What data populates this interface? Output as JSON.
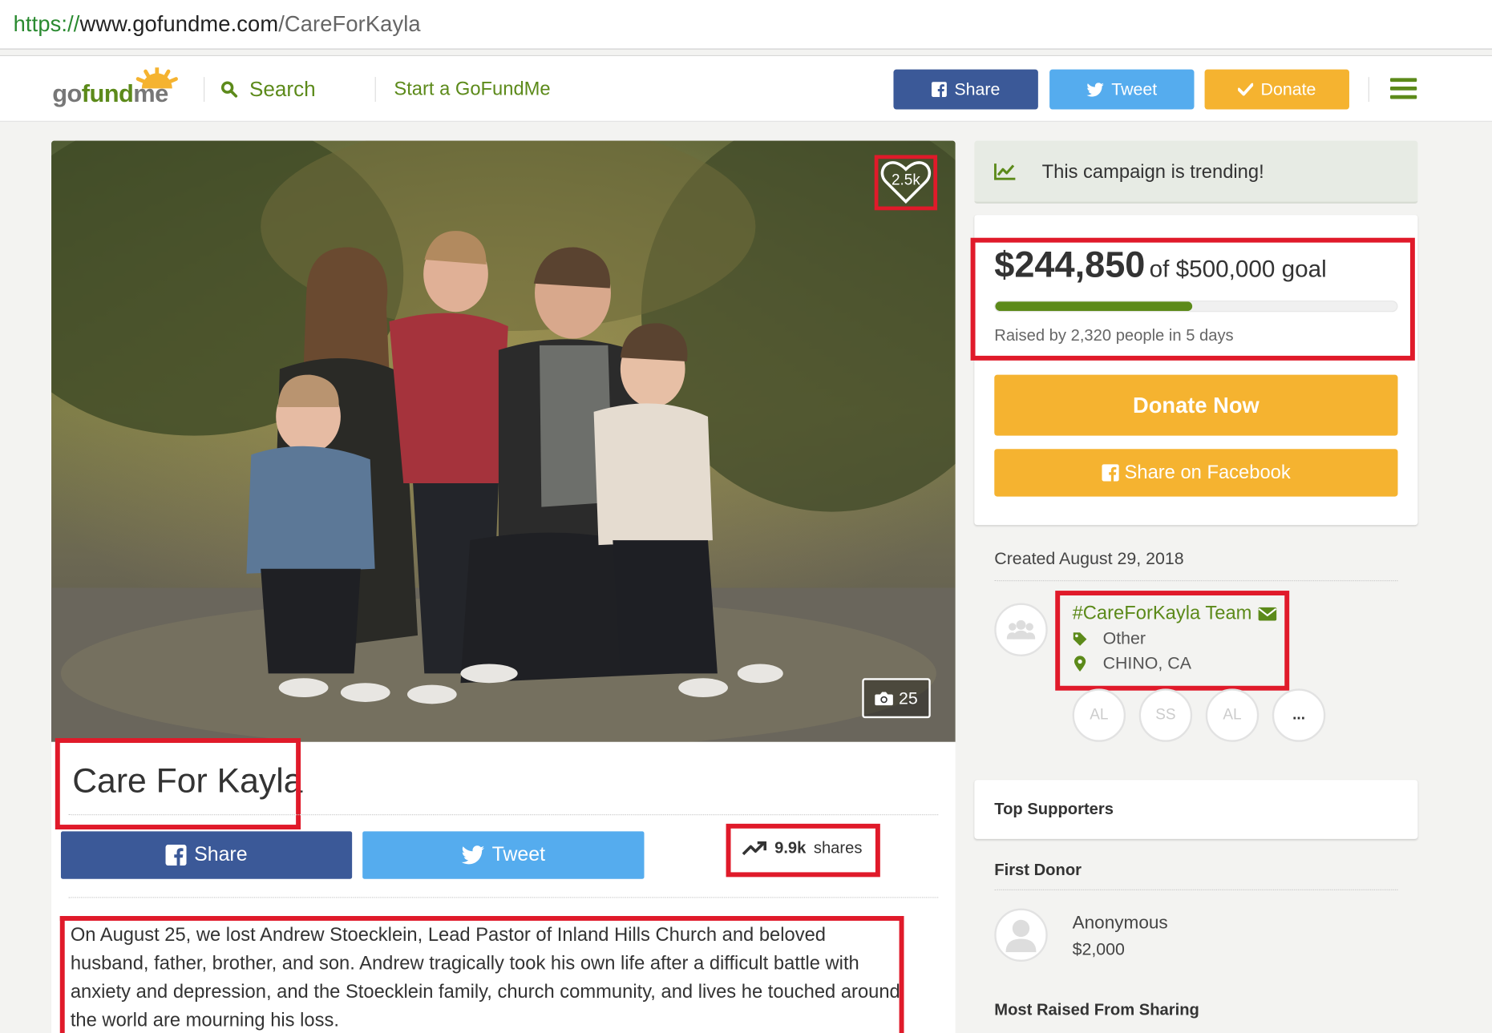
{
  "browser": {
    "url_scheme": "https://",
    "url_host": "www.gofundme.com",
    "url_path": "/CareForKayla"
  },
  "header": {
    "logo_go": "go",
    "logo_fund": "fund",
    "logo_me": "me",
    "search_label": "Search",
    "start_label": "Start a GoFundMe",
    "share_label": "Share",
    "tweet_label": "Tweet",
    "donate_label": "Donate"
  },
  "hero": {
    "hearts": "2.5k",
    "photo_count": "25"
  },
  "campaign": {
    "title": "Care For Kayla",
    "share_label": "Share",
    "tweet_label": "Tweet",
    "shares_count": "9.9k",
    "shares_word": "shares",
    "story": "On August 25, we lost Andrew Stoecklein, Lead Pastor of Inland Hills Church and beloved husband, father, brother, and son. Andrew tragically took his own life after a difficult battle with anxiety and depression, and the Stoecklein family, church community, and lives he touched around the world are mourning his loss."
  },
  "sidebar": {
    "trending_text": "This campaign is trending!",
    "raised_amount": "$244,850",
    "goal_text": "of $500,000 goal",
    "progress_fraction": 0.49,
    "raised_by": "Raised by 2,320 people in 5 days",
    "donate_now": "Donate Now",
    "share_facebook": "Share on Facebook",
    "created": "Created August 29, 2018",
    "organizer": "#CareForKayla Team",
    "category": "Other",
    "location": "CHINO, CA",
    "team_initials": [
      "AL",
      "SS",
      "AL",
      "..."
    ],
    "top_supporters": "Top Supporters",
    "first_donor_label": "First Donor",
    "first_donor_name": "Anonymous",
    "first_donor_amount": "$2,000",
    "most_raised_label": "Most Raised From Sharing"
  },
  "colors": {
    "brand_green": "#5c8a1a",
    "facebook_blue": "#3b5998",
    "twitter_blue": "#55acee",
    "donate_orange": "#f5b330",
    "highlight_red": "#e01a2a"
  }
}
